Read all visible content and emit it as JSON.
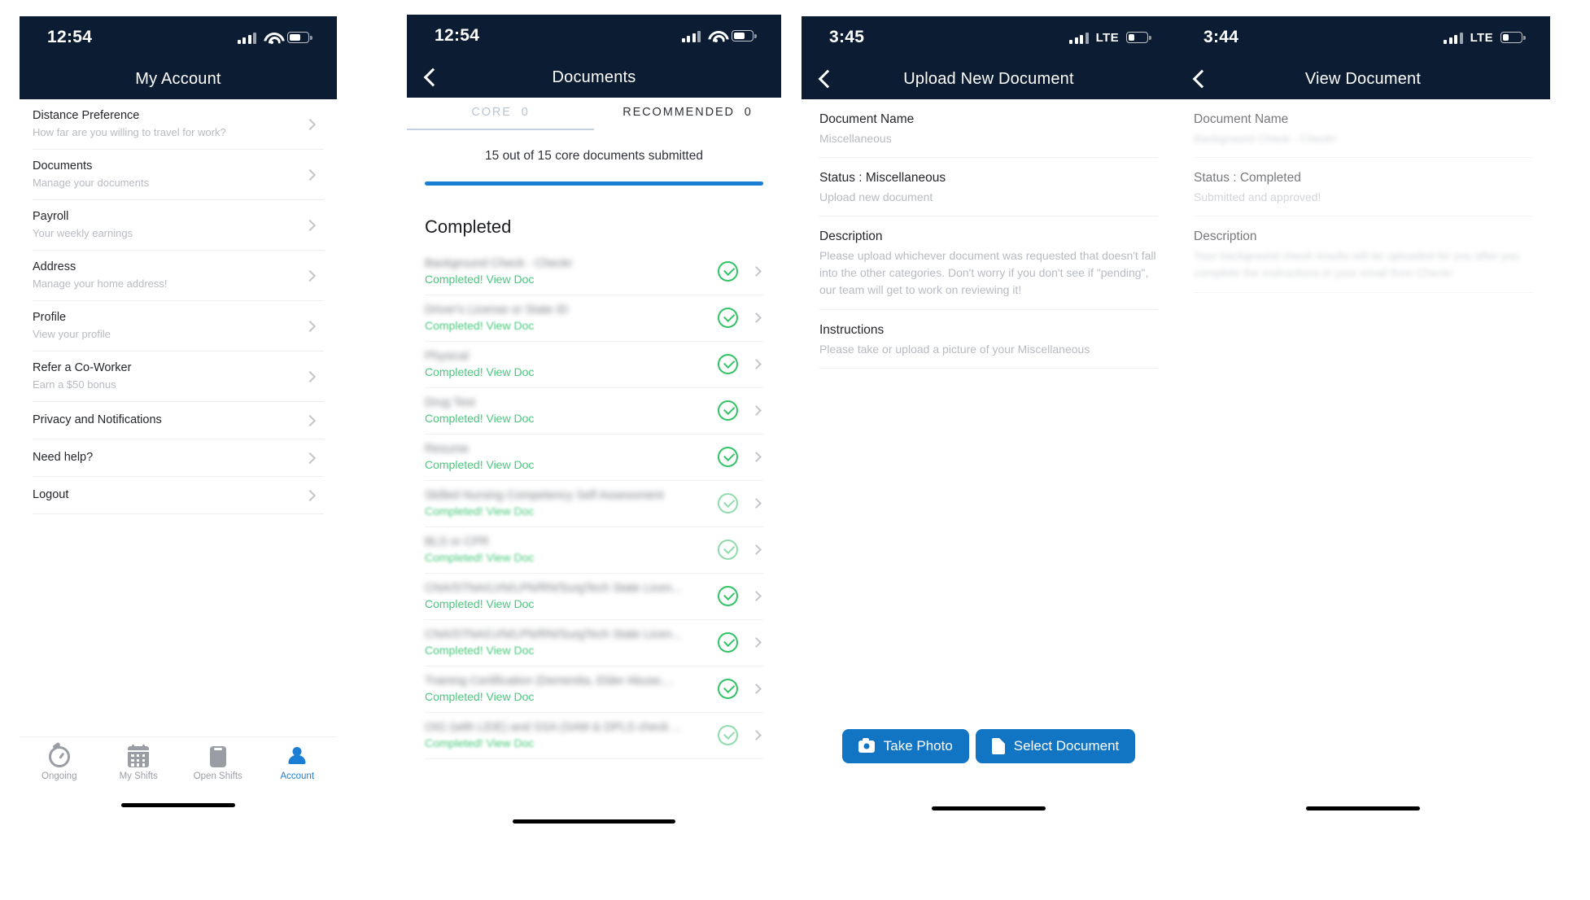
{
  "panel_account": {
    "status": {
      "time": "12:54",
      "network": "wifi",
      "icons": [
        "signal-bars-icon",
        "wifi-icon",
        "battery-icon"
      ]
    },
    "nav": {
      "title": "My Account",
      "back": false
    },
    "items": [
      {
        "title": "Distance Preference",
        "subtitle": "How far are you willing to travel for work?"
      },
      {
        "title": "Documents",
        "subtitle": "Manage your documents"
      },
      {
        "title": "Payroll",
        "subtitle": "Your weekly earnings"
      },
      {
        "title": "Address",
        "subtitle": "Manage your home address!"
      },
      {
        "title": "Profile",
        "subtitle": "View your profile"
      },
      {
        "title": "Refer a Co-Worker",
        "subtitle": "Earn a $50 bonus"
      },
      {
        "title": "Privacy and Notifications",
        "subtitle": ""
      },
      {
        "title": "Need help?",
        "subtitle": ""
      },
      {
        "title": "Logout",
        "subtitle": ""
      }
    ],
    "tabbar": [
      {
        "label": "Ongoing",
        "icon": "stopwatch-icon",
        "active": false
      },
      {
        "label": "My Shifts",
        "icon": "calendar-icon",
        "active": false
      },
      {
        "label": "Open Shifts",
        "icon": "clipboard-icon",
        "active": false
      },
      {
        "label": "Account",
        "icon": "person-icon",
        "active": true
      }
    ],
    "accent_active": "#1a7fd4",
    "accent_inactive": "#9a9ea4"
  },
  "panel_documents": {
    "status": {
      "time": "12:54",
      "network": "wifi"
    },
    "nav": {
      "title": "Documents",
      "back": true
    },
    "tabs": [
      {
        "label": "CORE",
        "count": "0",
        "active": true
      },
      {
        "label": "RECOMMENDED",
        "count": "0",
        "active": false
      }
    ],
    "summary": "15 out of 15 core documents submitted",
    "progress_percent": 100,
    "progress_color": "#1a7fd4",
    "section_heading": "Completed",
    "status_label": "Completed! View Doc",
    "rows": [
      {
        "name": "Background Check - Checkr"
      },
      {
        "name": "Driver's License or State ID"
      },
      {
        "name": "Physical"
      },
      {
        "name": "Drug Test"
      },
      {
        "name": "Resume"
      },
      {
        "name": "Skilled Nursing Competency Self Assessment"
      },
      {
        "name": "BLS or CPR"
      },
      {
        "name": "CNA/STNA/LVN/LPN/RN/SurgTech State Licen..."
      },
      {
        "name": "CNA/STNA/LVN/LPN/RN/SurgTech State Licen..."
      },
      {
        "name": "Training Certification (Dementia, Elder Abuse,..."
      },
      {
        "name": "OIG (with LEIE) and SSA (SAM & DPLS check ..."
      }
    ]
  },
  "panel_upload": {
    "status": {
      "time": "3:45",
      "network": "LTE"
    },
    "nav": {
      "title": "Upload New Document",
      "back": true
    },
    "sections": [
      {
        "label": "Document Name",
        "value": "Miscellaneous"
      },
      {
        "label": "Status : Miscellaneous",
        "value": "Upload new document"
      },
      {
        "label": "Description",
        "value": "Please upload whichever document was requested that doesn't fall into the other categories. Don't worry if you don't see if \"pending\", our team will get to work on reviewing it!"
      },
      {
        "label": "Instructions",
        "value": "Please take or upload a picture of your Miscellaneous"
      }
    ],
    "buttons": [
      {
        "label": "Take Photo",
        "icon": "camera-icon",
        "color": "#1275c4"
      },
      {
        "label": "Select Document",
        "icon": "document-icon",
        "color": "#1275c4"
      }
    ]
  },
  "panel_view": {
    "status": {
      "time": "3:44",
      "network": "LTE"
    },
    "nav": {
      "title": "View Document",
      "back": true
    },
    "sections": [
      {
        "label": "Document Name",
        "value": "Background Check - Checkr",
        "blurred": true
      },
      {
        "label": "Status : Completed",
        "value": "Submitted and approved!",
        "blurred": false
      },
      {
        "label": "Description",
        "value": "Your background check results will be uploaded for you after you complete the instructions in your email from Checkr",
        "blurred": true
      }
    ]
  }
}
